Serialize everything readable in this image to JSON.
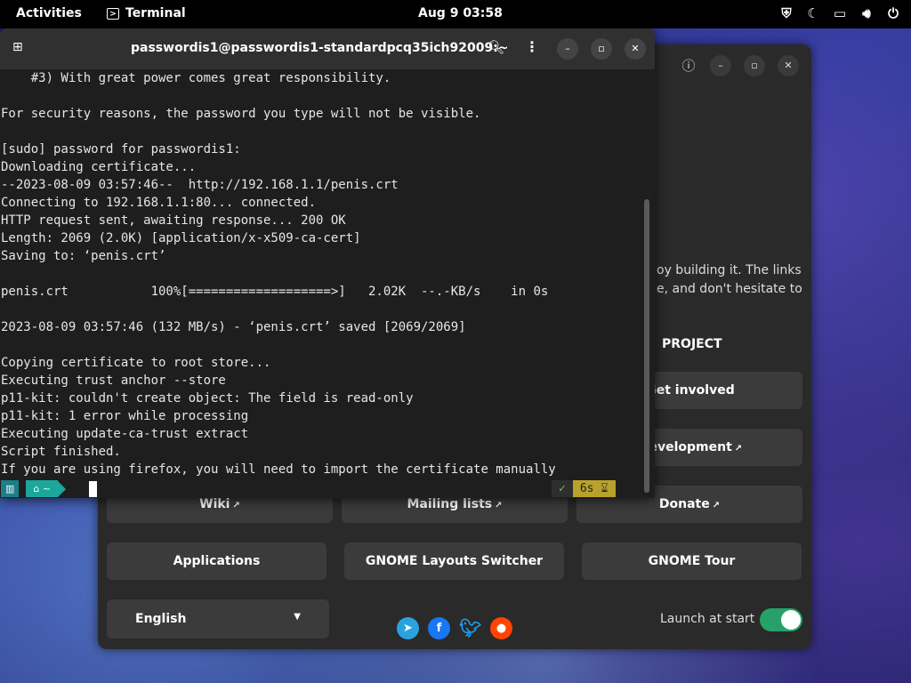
{
  "topbar": {
    "activities": "Activities",
    "app_name": "Terminal",
    "clock": "Aug 9  03:58",
    "tray_icons": [
      "shield-icon",
      "night-mode-icon",
      "screen-icon",
      "volume-icon",
      "power-icon"
    ]
  },
  "terminal": {
    "title": "passwordis1@passwordis1-standardpcq35ich92009:~",
    "lines": [
      "    #3) With great power comes great responsibility.",
      "",
      "For security reasons, the password you type will not be visible.",
      "",
      "[sudo] password for passwordis1:",
      "Downloading certificate...",
      "--2023-08-09 03:57:46--  http://192.168.1.1/penis.crt",
      "Connecting to 192.168.1.1:80... connected.",
      "HTTP request sent, awaiting response... 200 OK",
      "Length: 2069 (2.0K) [application/x-x509-ca-cert]",
      "Saving to: ‘penis.crt’",
      "",
      "penis.crt           100%[===================>]   2.02K  --.-KB/s    in 0s",
      "",
      "2023-08-09 03:57:46 (132 MB/s) - ‘penis.crt’ saved [2069/2069]",
      "",
      "Copying certificate to root store...",
      "Executing trust anchor --store",
      "p11-kit: couldn't create object: The field is read-only",
      "p11-kit: 1 error while processing",
      "Executing update-ca-trust extract",
      "Script finished.",
      "If you are using firefox, you will need to import the certificate manually"
    ],
    "prompt_home": "~",
    "status_ok": "✓",
    "status_duration": "6s"
  },
  "welcome": {
    "para_line1": "oy building it. The links",
    "para_line2": "e, and don't hesitate to",
    "project_heading": "PROJECT",
    "get_involved": "Get involved",
    "development": "Development",
    "wiki": "Wiki",
    "mailing_lists": "Mailing lists",
    "donate": "Donate",
    "applications": "Applications",
    "layouts_switcher": "GNOME Layouts Switcher",
    "gnome_tour": "GNOME Tour",
    "language": "English",
    "launch_at_start": "Launch at start",
    "launch_at_start_enabled": true
  },
  "colors": {
    "accent_green": "#26a269",
    "prompt_teal": "#1ba79c",
    "duration_yellow": "#b9a22a"
  }
}
